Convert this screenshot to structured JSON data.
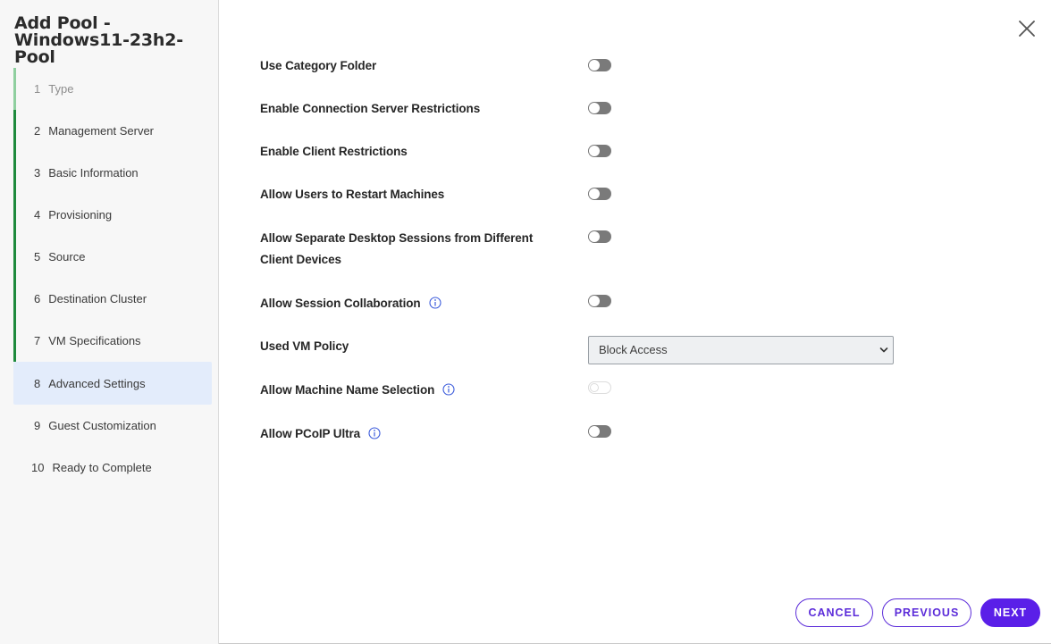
{
  "dialog": {
    "title": "Add Pool - Windows11-23h2-Pool"
  },
  "steps": [
    {
      "num": "1",
      "label": "Type"
    },
    {
      "num": "2",
      "label": "Management Server"
    },
    {
      "num": "3",
      "label": "Basic Information"
    },
    {
      "num": "4",
      "label": "Provisioning"
    },
    {
      "num": "5",
      "label": "Source"
    },
    {
      "num": "6",
      "label": "Destination Cluster"
    },
    {
      "num": "7",
      "label": "VM Specifications"
    },
    {
      "num": "8",
      "label": "Advanced Settings"
    },
    {
      "num": "9",
      "label": "Guest Customization"
    },
    {
      "num": "10",
      "label": "Ready to Complete"
    }
  ],
  "settings": {
    "use_category_folder": {
      "label": "Use Category Folder",
      "enabled": false
    },
    "enable_connection_server_restrictions": {
      "label": "Enable Connection Server Restrictions",
      "enabled": false
    },
    "enable_client_restrictions": {
      "label": "Enable Client Restrictions",
      "enabled": false
    },
    "allow_users_restart": {
      "label": "Allow Users to Restart Machines",
      "enabled": false
    },
    "allow_separate_sessions": {
      "label": "Allow Separate Desktop Sessions from Different Client Devices",
      "enabled": false
    },
    "allow_session_collaboration": {
      "label": "Allow Session Collaboration",
      "enabled": false
    },
    "used_vm_policy": {
      "label": "Used VM Policy",
      "value": "Block Access"
    },
    "allow_machine_name_selection": {
      "label": "Allow Machine Name Selection",
      "enabled": false,
      "disabled": true
    },
    "allow_pcoip_ultra": {
      "label": "Allow PCoIP Ultra",
      "enabled": false
    }
  },
  "footer": {
    "cancel": "CANCEL",
    "previous": "PREVIOUS",
    "next": "NEXT"
  },
  "colors": {
    "accent": "#5a1fe8",
    "step_done": "#1e8a3c",
    "step_active_bg": "#e3ecfb"
  }
}
